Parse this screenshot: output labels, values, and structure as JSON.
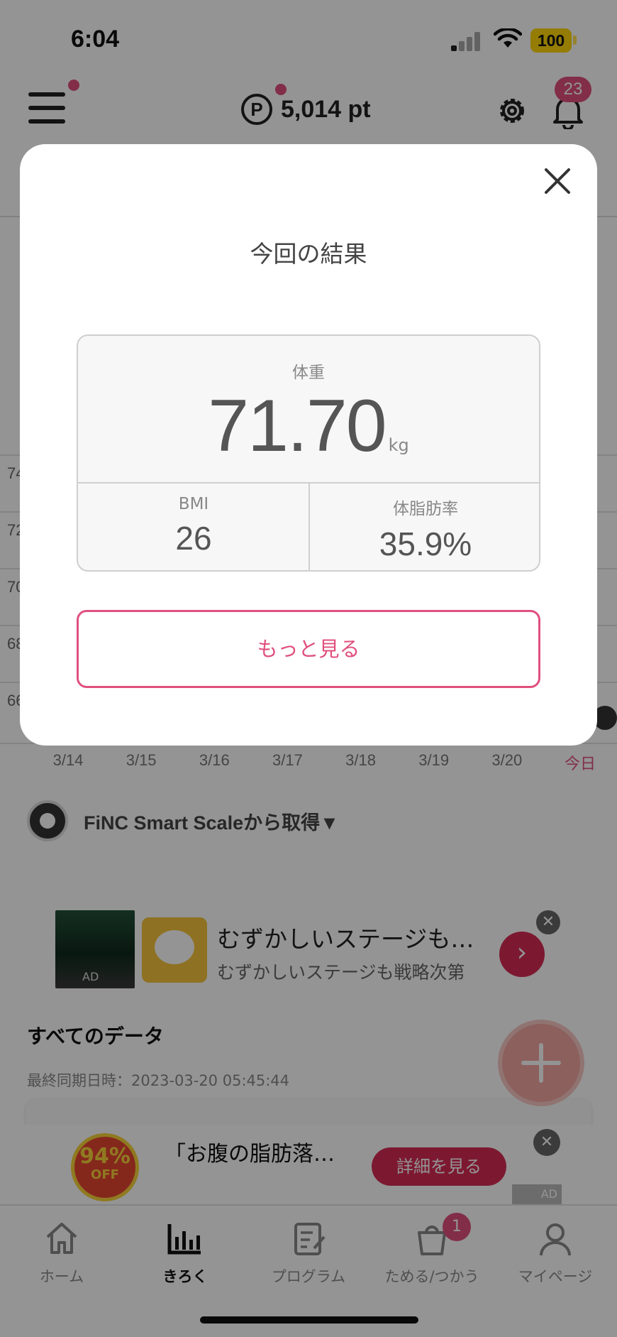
{
  "status_bar": {
    "time": "6:04",
    "battery": "100"
  },
  "header": {
    "points": "5,014 pt",
    "points_symbol": "P",
    "notifications_count": "23"
  },
  "chart": {
    "y_labels": [
      "74",
      "72",
      "70",
      "68",
      "66"
    ],
    "x_labels": [
      "3/14",
      "3/15",
      "3/16",
      "3/17",
      "3/18",
      "3/19",
      "3/20",
      "今日"
    ]
  },
  "source": {
    "label": "FiNC Smart Scaleから取得▼"
  },
  "ad_banner": {
    "title": "むずかしいステージも…",
    "subtitle": "むずかしいステージも戦略次第",
    "thumb_label": "AD",
    "go_symbol": "›",
    "close_symbol": "✕"
  },
  "all_data": {
    "title": "すべてのデータ",
    "last_sync": "最終同期日時：2023-03-20 05:45:44"
  },
  "bottom_ad": {
    "badge_number": "94%",
    "badge_off": "OFF",
    "title": "「お腹の脂肪落…",
    "detail_button": "詳細を見る",
    "ad_mark": "AD",
    "close_symbol": "✕"
  },
  "tabbar": {
    "items": [
      {
        "label": "ホーム",
        "icon": "home-icon"
      },
      {
        "label": "きろく",
        "icon": "chart-icon",
        "active": true
      },
      {
        "label": "プログラム",
        "icon": "program-icon"
      },
      {
        "label": "ためる/つかう",
        "icon": "points-bag-icon",
        "badge": "1"
      },
      {
        "label": "マイページ",
        "icon": "person-icon"
      }
    ]
  },
  "modal": {
    "title": "今回の結果",
    "weight_label": "体重",
    "weight_value": "71.70",
    "weight_unit": "kg",
    "bmi_label": "BMI",
    "bmi_value": "26",
    "body_fat_label": "体脂肪率",
    "body_fat_value": "35.9%",
    "more_button": "もっと見る"
  },
  "colors": {
    "accent": "#e0507e",
    "ad_red": "#d62c55",
    "battery": "#ffd60a"
  }
}
